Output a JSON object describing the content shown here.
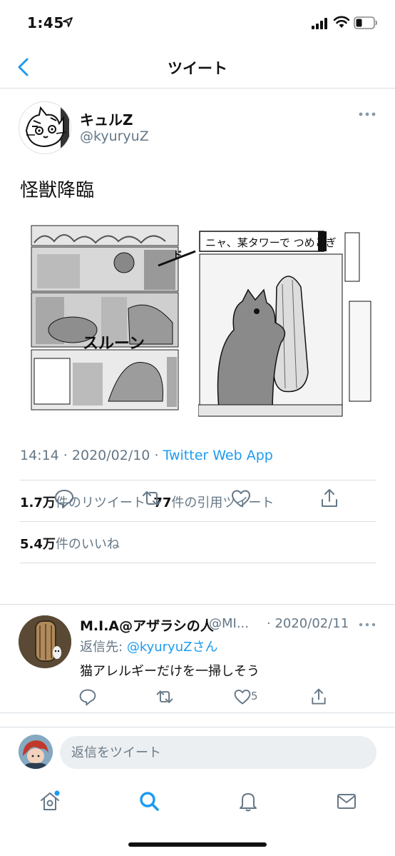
{
  "status_bar": {
    "time": "1:45"
  },
  "nav": {
    "title": "ツイート"
  },
  "tweet": {
    "author_name": "キュルZ",
    "author_handle": "@kyuryuZ",
    "text": "怪獣降臨",
    "meta": {
      "time": "14:14",
      "date": "2020/02/10",
      "source": "Twitter Web App",
      "sep": " · "
    },
    "stats": {
      "retweet_count": "1.7万",
      "retweet_label": "件のリツイート",
      "quote_count": "77",
      "quote_label": "件の引用ツイート",
      "like_count": "5.4万",
      "like_label": "件のいいね"
    }
  },
  "reply": {
    "name": "M.I.A@アザラシの人",
    "handle": "@MI...",
    "date": "· 2020/02/11",
    "reply_to_label": "返信先:",
    "reply_to_user": "@kyuryuZさん",
    "text": "猫アレルギーだけを一掃しそう",
    "like_count": "5"
  },
  "compose": {
    "placeholder": "返信をツイート"
  },
  "colors": {
    "accent": "#1d9bf0",
    "secondary_text": "#657786",
    "divider": "#d9dfe4"
  }
}
